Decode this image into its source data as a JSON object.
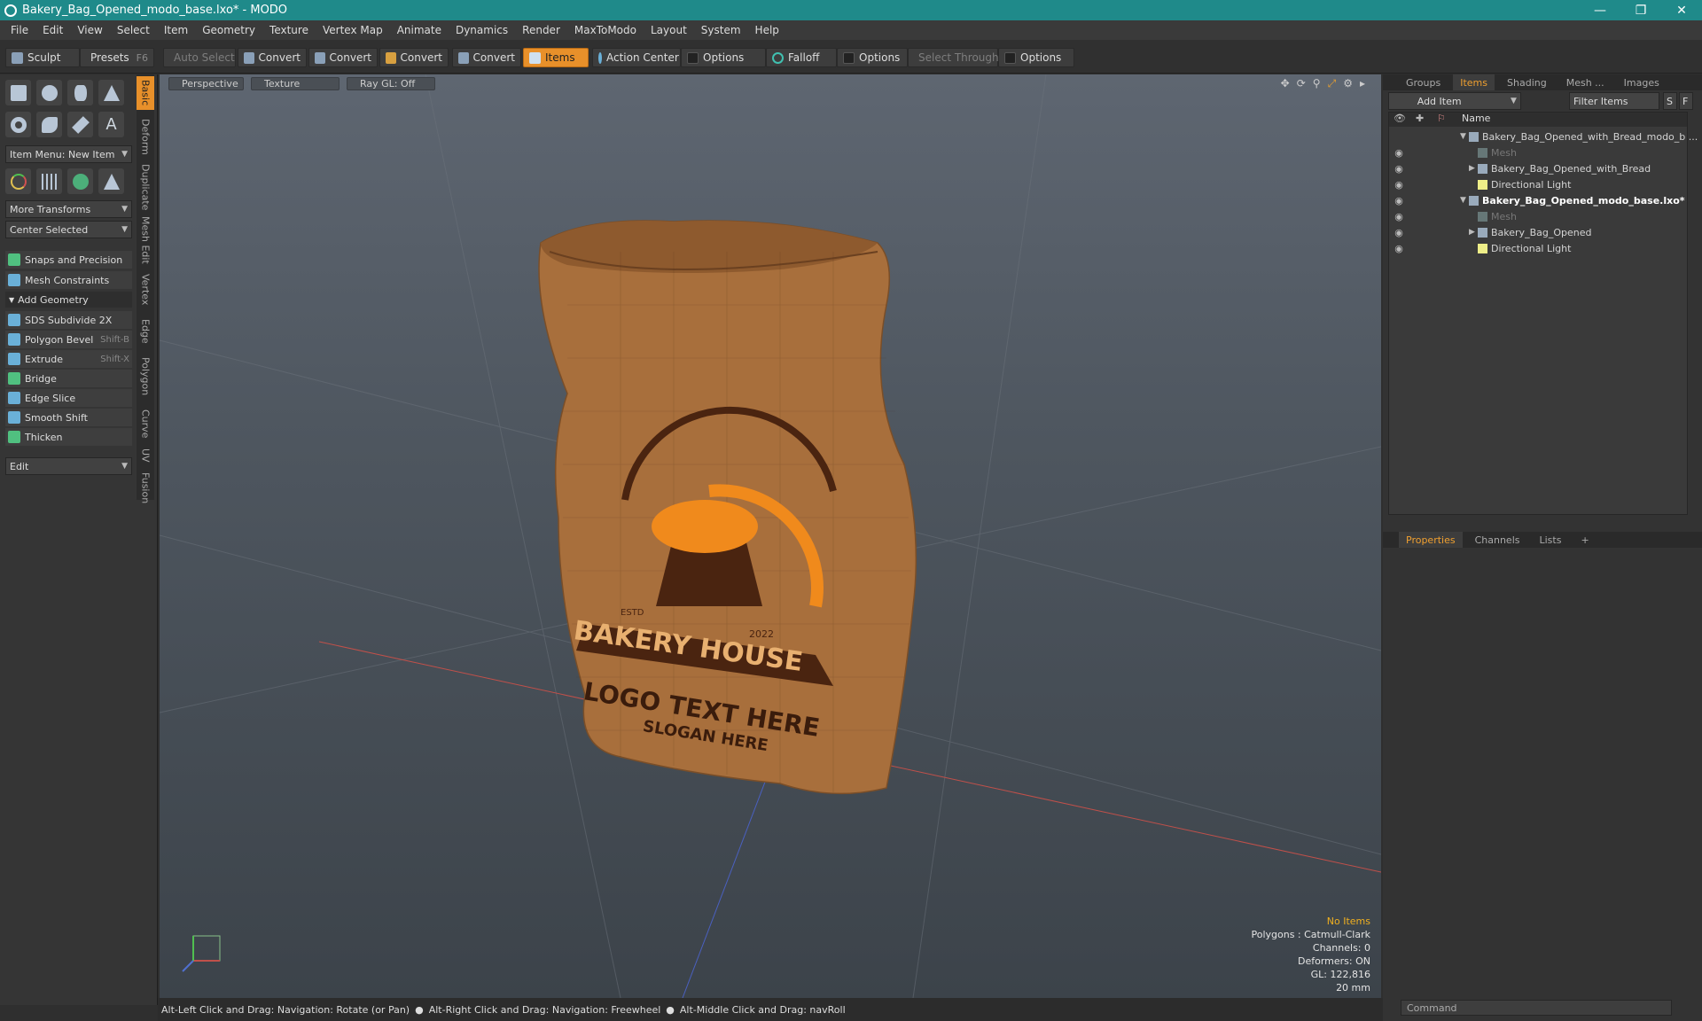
{
  "window": {
    "title": "Bakery_Bag_Opened_modo_base.lxo* - MODO",
    "min": "—",
    "max": "❐",
    "close": "✕"
  },
  "menu": [
    "File",
    "Edit",
    "View",
    "Select",
    "Item",
    "Geometry",
    "Texture",
    "Vertex Map",
    "Animate",
    "Dynamics",
    "Render",
    "MaxToModo",
    "Layout",
    "System",
    "Help"
  ],
  "toolbar": {
    "sculpt": "Sculpt",
    "presets": "Presets",
    "presets_key": "F6",
    "auto_select": "Auto Select",
    "convert1": "Convert",
    "convert2": "Convert",
    "convert3": "Convert",
    "convert4": "Convert",
    "items": "Items",
    "action_center": "Action Center",
    "options1": "Options",
    "falloff": "Falloff",
    "options2": "Options",
    "select_through": "Select Through",
    "options3": "Options"
  },
  "left": {
    "item_menu": "Item Menu: New Item",
    "more_transforms": "More Transforms",
    "center_selected": "Center Selected",
    "snaps": "Snaps and Precision",
    "mesh_constraints": "Mesh Constraints",
    "add_geometry": "Add Geometry",
    "tools": [
      {
        "label": "SDS Subdivide 2X",
        "key": ""
      },
      {
        "label": "Polygon Bevel",
        "key": "Shift-B"
      },
      {
        "label": "Extrude",
        "key": "Shift-X"
      },
      {
        "label": "Bridge",
        "key": ""
      },
      {
        "label": "Edge Slice",
        "key": ""
      },
      {
        "label": "Smooth Shift",
        "key": ""
      },
      {
        "label": "Thicken",
        "key": ""
      }
    ],
    "edit": "Edit",
    "side_tabs": [
      "Basic",
      "Deform",
      "Duplicate",
      "Mesh Edit",
      "Vertex",
      "Edge",
      "Polygon",
      "Curve",
      "UV",
      "Fusion"
    ]
  },
  "viewport": {
    "tab_perspective": "Perspective",
    "tab_texture": "Texture",
    "tab_raygl": "Ray GL: Off",
    "logo_brand": "BAKERY HOUSE",
    "logo_estd": "ESTD",
    "logo_year": "2022",
    "logo_text": "LOGO TEXT HERE",
    "logo_slogan": "SLOGAN HERE",
    "info": {
      "no_items": "No Items",
      "polygons": "Polygons : Catmull-Clark",
      "channels": "Channels: 0",
      "deformers": "Deformers: ON",
      "gl": "GL: 122,816",
      "scale": "20 mm"
    }
  },
  "right": {
    "tabs": [
      "Groups",
      "Items",
      "Shading",
      "Mesh ...",
      "Images"
    ],
    "add_item": "Add Item",
    "filter_items": "Filter Items",
    "btn_s": "S",
    "btn_f": "F",
    "col_name": "Name",
    "rows": [
      {
        "label": "Bakery_Bag_Opened_with_Bread_modo_b ..."
      },
      {
        "label": "Mesh"
      },
      {
        "label": "Bakery_Bag_Opened_with_Bread"
      },
      {
        "label": "Directional Light"
      },
      {
        "label": "Bakery_Bag_Opened_modo_base.lxo*"
      },
      {
        "label": "Mesh"
      },
      {
        "label": "Bakery_Bag_Opened"
      },
      {
        "label": "Directional Light"
      }
    ],
    "prop_tabs": [
      "Properties",
      "Channels",
      "Lists"
    ],
    "command_placeholder": "Command"
  },
  "status": {
    "hint1": "Alt-Left Click and Drag: Navigation: Rotate (or Pan)",
    "hint2": "Alt-Right Click and Drag: Navigation: Freewheel",
    "hint3": "Alt-Middle Click and Drag: navRoll"
  }
}
